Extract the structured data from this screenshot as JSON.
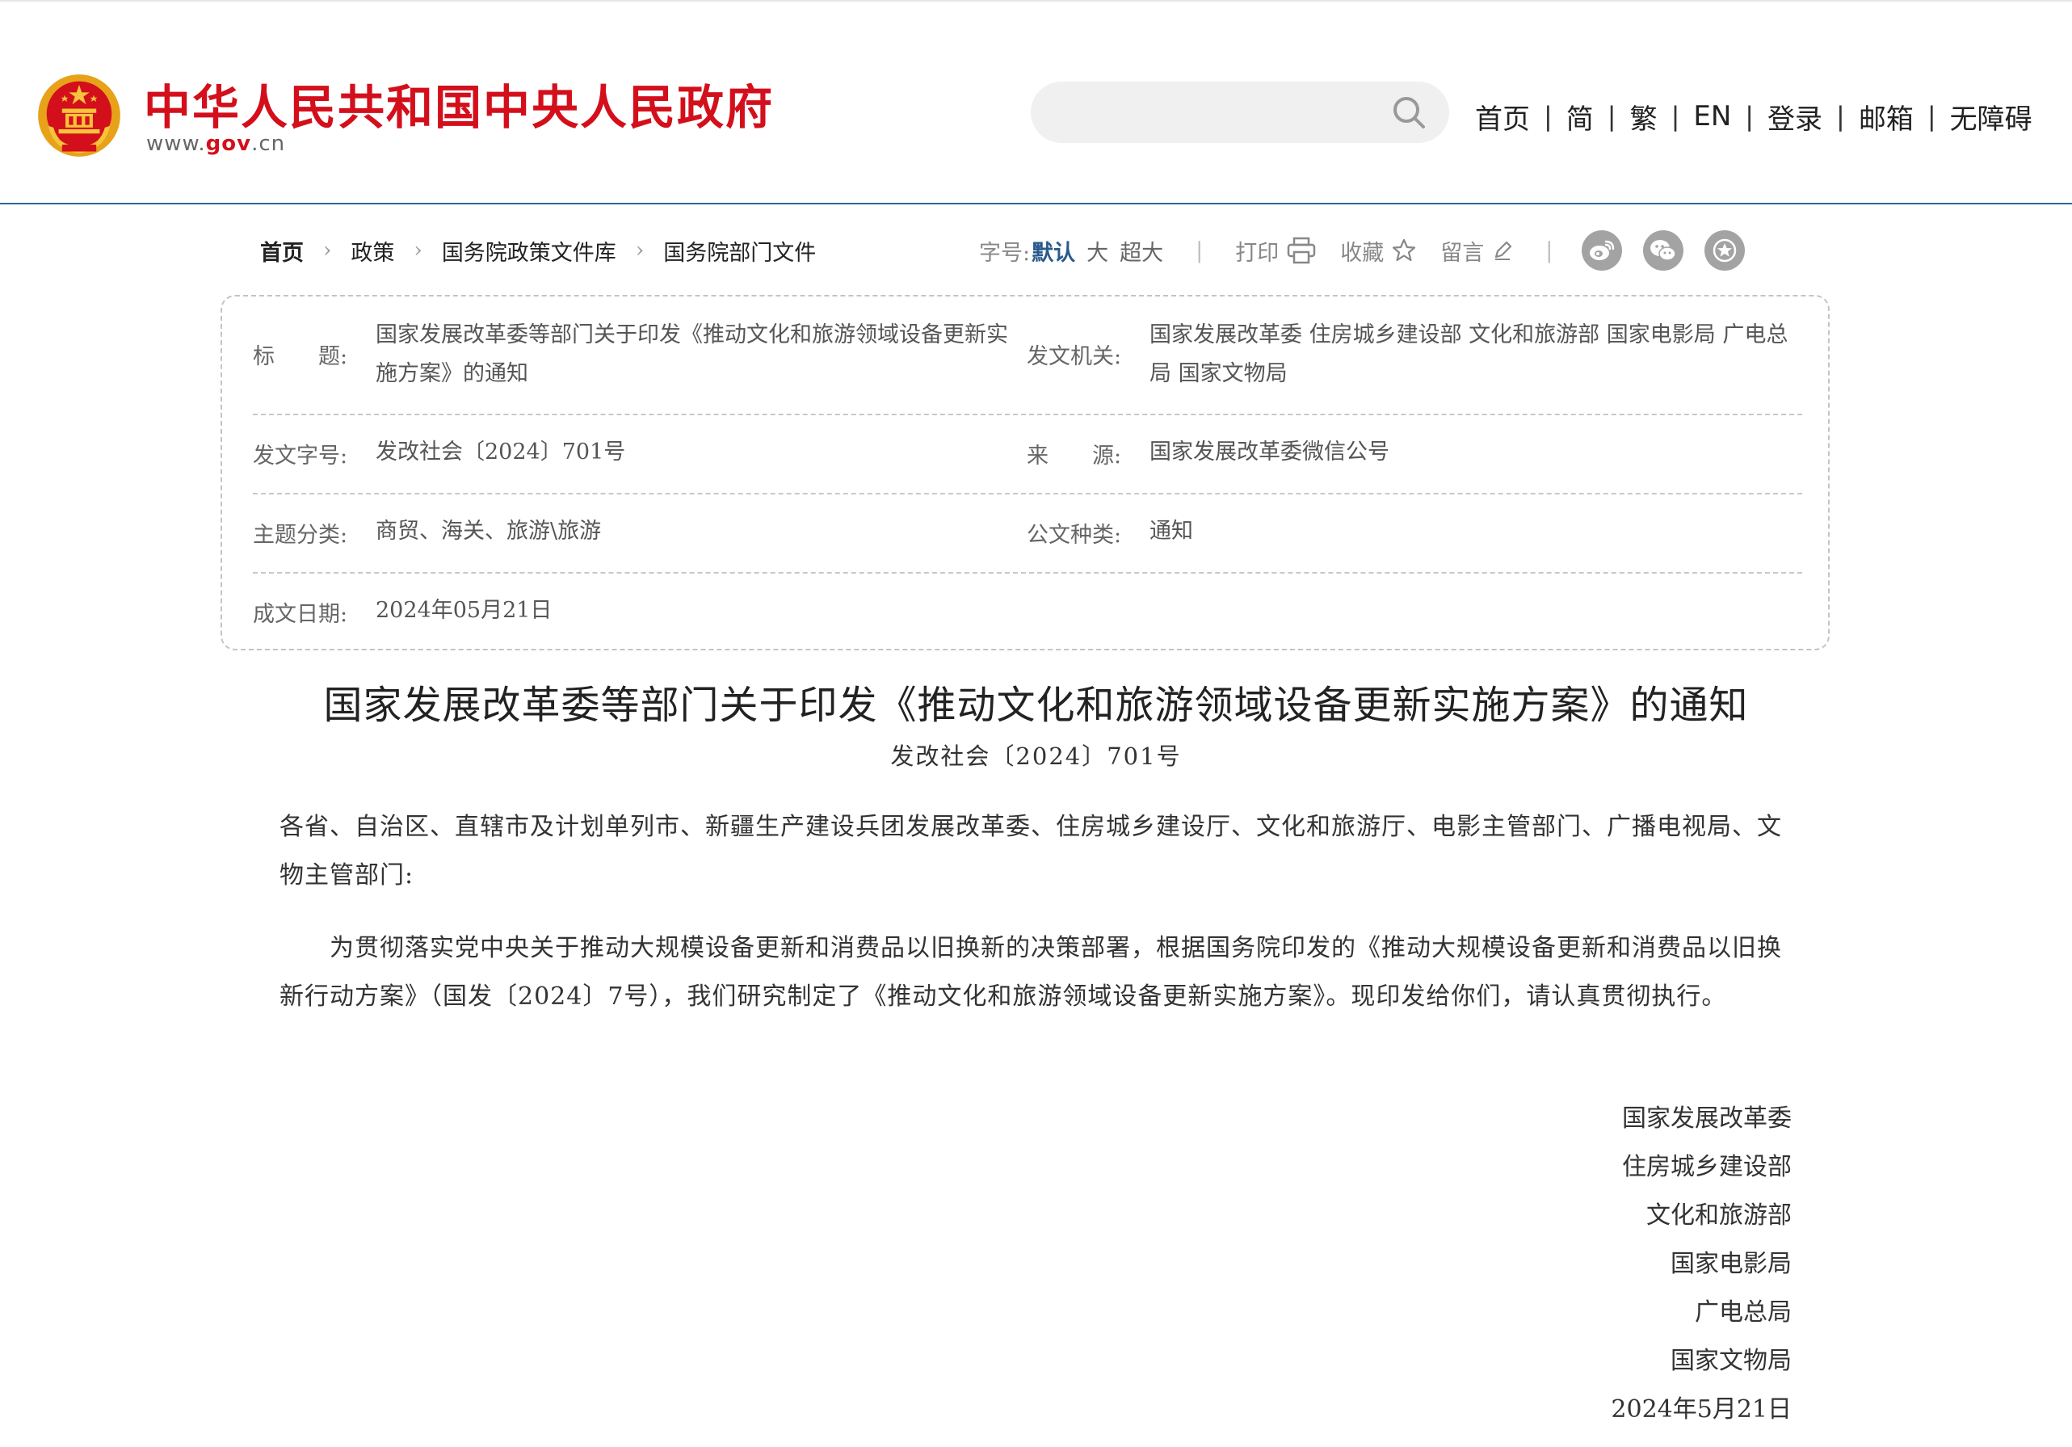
{
  "header": {
    "site_title": "中华人民共和国中央人民政府",
    "site_url_prefix": "www.",
    "site_url_gov": "gov",
    "site_url_suffix": ".cn",
    "search": {
      "placeholder": "",
      "value": ""
    },
    "nav": [
      "首页",
      "简",
      "繁",
      "EN",
      "登录",
      "邮箱",
      "无障碍"
    ],
    "nav_separator": "|",
    "colors": {
      "brand_red": "#d40f1c",
      "border_blue": "#2c6a9c"
    }
  },
  "breadcrumb": {
    "items": [
      "首页",
      "政策",
      "国务院政策文件库",
      "国务院部门文件"
    ],
    "arrow": "›"
  },
  "tools": {
    "font_size_label": "字号:",
    "font_default": "默认",
    "font_large": "大",
    "font_xlarge": "超大",
    "separator": "|",
    "print_label": "打印",
    "favorite_label": "收藏",
    "comment_label": "留言",
    "share_icons": [
      "weibo-icon",
      "wechat-icon",
      "star-share-icon"
    ]
  },
  "info": {
    "title_label": "标　　题:",
    "title_value": "国家发展改革委等部门关于印发《推动文化和旅游领域设备更新实施方案》的通知",
    "issuer_label": "发文机关:",
    "issuer_value": "国家发展改革委  住房城乡建设部  文化和旅游部  国家电影局  广电总局  国家文物局",
    "docno_label": "发文字号:",
    "docno_value": "发改社会〔2024〕701号",
    "source_label": "来　　源:",
    "source_value": "国家发展改革委微信公号",
    "topic_label": "主题分类:",
    "topic_value": "商贸、海关、旅游\\旅游",
    "type_label": "公文种类:",
    "type_value": "通知",
    "date_label": "成文日期:",
    "date_value": "2024年05月21日"
  },
  "article": {
    "title": "国家发展改革委等部门关于印发《推动文化和旅游领域设备更新实施方案》的通知",
    "doc_number": "发改社会〔2024〕701号",
    "addressees": "各省、自治区、直辖市及计划单列市、新疆生产建设兵团发展改革委、住房城乡建设厅、文化和旅游厅、电影主管部门、广播电视局、文物主管部门:",
    "body": "为贯彻落实党中央关于推动大规模设备更新和消费品以旧换新的决策部署，根据国务院印发的《推动大规模设备更新和消费品以旧换新行动方案》（国发〔2024〕7号），我们研究制定了《推动文化和旅游领域设备更新实施方案》。现印发给你们，请认真贯彻执行。",
    "signers": [
      "国家发展改革委",
      "住房城乡建设部",
      "文化和旅游部",
      "国家电影局",
      "广电总局",
      "国家文物局"
    ],
    "sign_date": "2024年5月21日"
  }
}
